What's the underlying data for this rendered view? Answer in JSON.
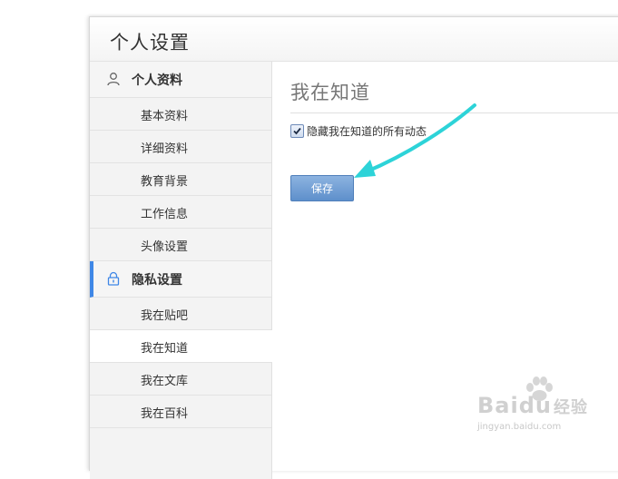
{
  "page": {
    "title": "个人设置"
  },
  "sidebar": {
    "sections": [
      {
        "label": "个人资料",
        "icon": "user-icon",
        "items": [
          "基本资料",
          "详细资料",
          "教育背景",
          "工作信息",
          "头像设置"
        ]
      },
      {
        "label": "隐私设置",
        "icon": "lock-icon",
        "active": true,
        "items": [
          "我在贴吧",
          "我在知道",
          "我在文库",
          "我在百科"
        ]
      }
    ],
    "selected_item": "我在知道"
  },
  "content": {
    "title": "我在知道",
    "checkbox_label": "隐藏我在知道的所有动态",
    "checkbox_checked": true,
    "save_label": "保存"
  },
  "annotation": {
    "arrow_color": "#2dd3d8"
  },
  "watermark": {
    "logo_text": "Baidu",
    "logo_text_cn": "经验",
    "url": "jingyan.baidu.com"
  },
  "colors": {
    "accent": "#3f87e6",
    "button": "#6f9fd6"
  }
}
